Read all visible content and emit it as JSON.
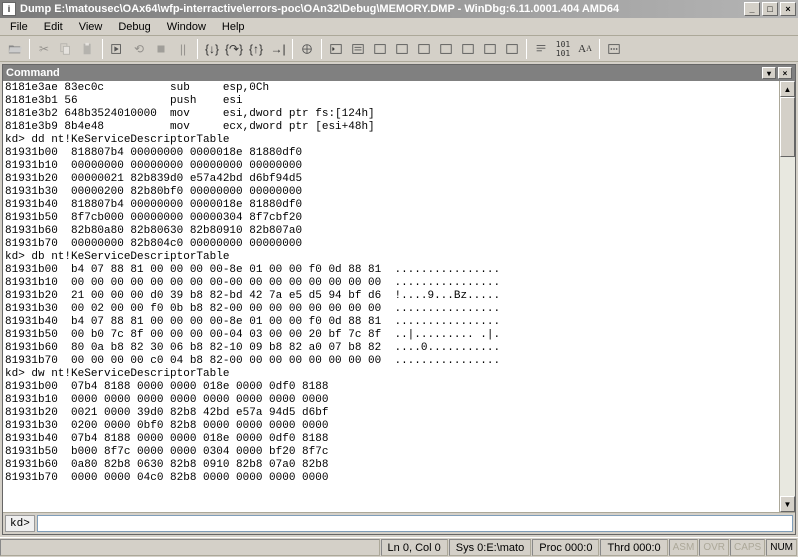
{
  "title": "Dump E:\\matousec\\OAx64\\wfp-interractive\\errors-poc\\OAn32\\Debug\\MEMORY.DMP - WinDbg:6.11.0001.404 AMD64",
  "menu": {
    "items": [
      "File",
      "Edit",
      "View",
      "Debug",
      "Window",
      "Help"
    ]
  },
  "cmd": {
    "header": "Command",
    "prompt": "kd>"
  },
  "output_lines": [
    "8181e3ae 83ec0c          sub     esp,0Ch",
    "8181e3b1 56              push    esi",
    "8181e3b2 648b3524010000  mov     esi,dword ptr fs:[124h]",
    "8181e3b9 8b4e48          mov     ecx,dword ptr [esi+48h]",
    "kd> dd nt!KeServiceDescriptorTable",
    "81931b00  818807b4 00000000 0000018e 81880df0",
    "81931b10  00000000 00000000 00000000 00000000",
    "81931b20  00000021 82b839d0 e57a42bd d6bf94d5",
    "81931b30  00000200 82b80bf0 00000000 00000000",
    "81931b40  818807b4 00000000 0000018e 81880df0",
    "81931b50  8f7cb000 00000000 00000304 8f7cbf20",
    "81931b60  82b80a80 82b80630 82b80910 82b807a0",
    "81931b70  00000000 82b804c0 00000000 00000000",
    "kd> db nt!KeServiceDescriptorTable",
    "81931b00  b4 07 88 81 00 00 00 00-8e 01 00 00 f0 0d 88 81  ................",
    "81931b10  00 00 00 00 00 00 00 00-00 00 00 00 00 00 00 00  ................",
    "81931b20  21 00 00 00 d0 39 b8 82-bd 42 7a e5 d5 94 bf d6  !....9...Bz.....",
    "81931b30  00 02 00 00 f0 0b b8 82-00 00 00 00 00 00 00 00  ................",
    "81931b40  b4 07 88 81 00 00 00 00-8e 01 00 00 f0 0d 88 81  ................",
    "81931b50  00 b0 7c 8f 00 00 00 00-04 03 00 00 20 bf 7c 8f  ..|......... .|.",
    "81931b60  80 0a b8 82 30 06 b8 82-10 09 b8 82 a0 07 b8 82  ....0...........",
    "81931b70  00 00 00 00 c0 04 b8 82-00 00 00 00 00 00 00 00  ................",
    "kd> dw nt!KeServiceDescriptorTable",
    "81931b00  07b4 8188 0000 0000 018e 0000 0df0 8188",
    "81931b10  0000 0000 0000 0000 0000 0000 0000 0000",
    "81931b20  0021 0000 39d0 82b8 42bd e57a 94d5 d6bf",
    "81931b30  0200 0000 0bf0 82b8 0000 0000 0000 0000",
    "81931b40  07b4 8188 0000 0000 018e 0000 0df0 8188",
    "81931b50  b000 8f7c 0000 0000 0304 0000 bf20 8f7c",
    "81931b60  0a80 82b8 0630 82b8 0910 82b8 07a0 82b8",
    "81931b70  0000 0000 04c0 82b8 0000 0000 0000 0000"
  ],
  "status": {
    "ln": "Ln 0, Col 0",
    "sys": "Sys 0:E:\\mato",
    "proc": "Proc 000:0",
    "thrd": "Thrd 000:0",
    "asm": "ASM",
    "ovr": "OVR",
    "caps": "CAPS",
    "num": "NUM"
  }
}
